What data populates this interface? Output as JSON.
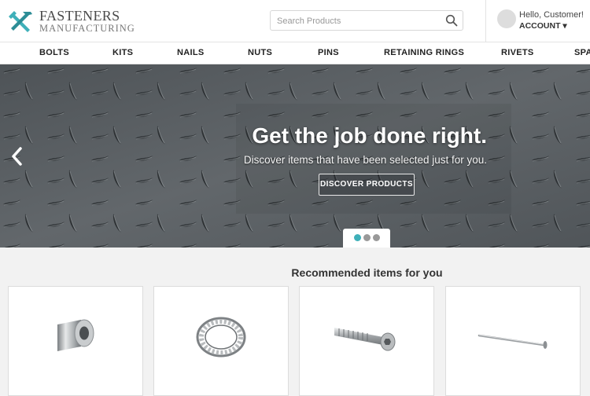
{
  "brand": {
    "name_line1": "FASTENERS",
    "name_line2": "MANUFACTURING",
    "accent": "#3fb0b9"
  },
  "search": {
    "placeholder": "Search Products",
    "icon": "search-icon"
  },
  "account": {
    "greeting": "Hello, Customer!",
    "label": "ACCOUNT",
    "caret": "▾"
  },
  "nav": {
    "items": [
      "BOLTS",
      "KITS",
      "NAILS",
      "NUTS",
      "PINS",
      "RETAINING RINGS",
      "RIVETS",
      "SPA"
    ]
  },
  "hero": {
    "title": "Get the job done right.",
    "subtitle": "Discover items that have been selected just for you.",
    "cta": "DISCOVER PRODUCTS",
    "prev_icon": "chevron-left-icon",
    "slides_total": 3,
    "active_slide": 1,
    "dot_active_color": "#3fb0b9",
    "dot_inactive_color": "#999999"
  },
  "recommended": {
    "title": "Recommended items for you",
    "items": [
      {
        "icon": "spacer-bushing-icon"
      },
      {
        "icon": "lock-washer-icon"
      },
      {
        "icon": "socket-cap-screw-icon"
      },
      {
        "icon": "nail-icon"
      }
    ]
  }
}
